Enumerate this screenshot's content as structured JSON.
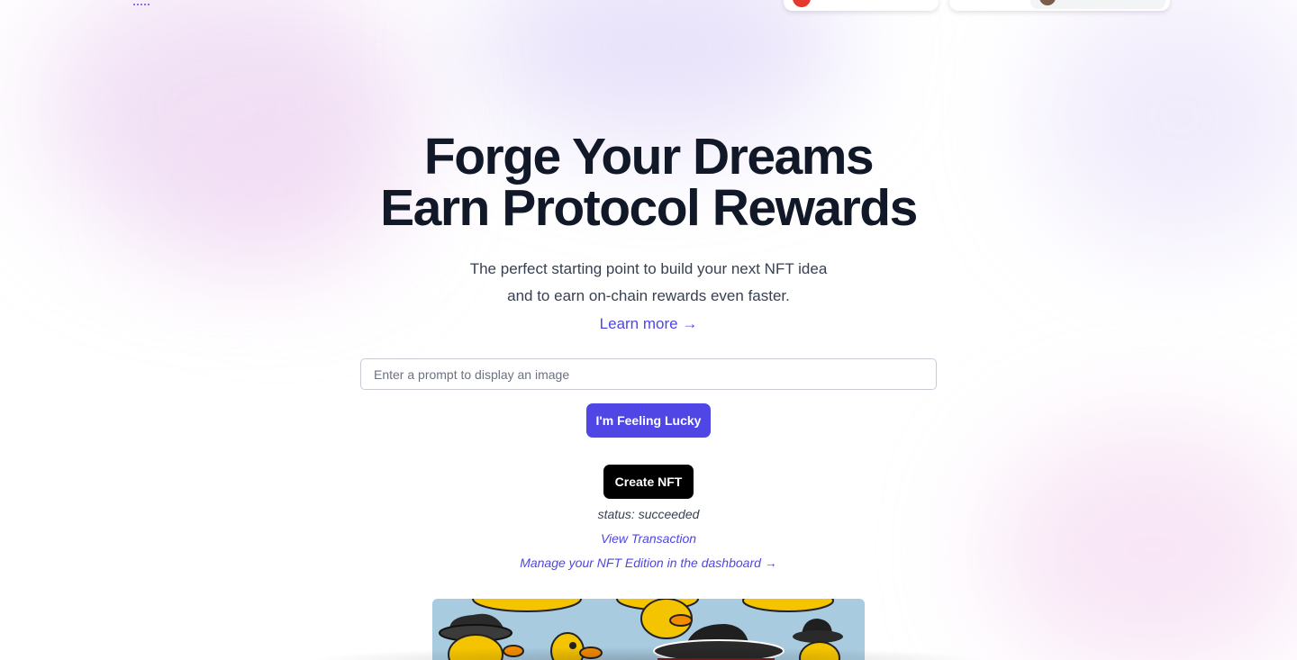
{
  "header": {
    "logo_icon": "dots-logo-icon",
    "chain_badge_icon": "red-chain-icon",
    "account_avatar_icon": "avatar-icon"
  },
  "hero": {
    "title_line1": "Forge Your Dreams",
    "title_line2": "Earn Protocol Rewards",
    "subtitle_line1": "The perfect starting point to build your next NFT idea",
    "subtitle_line2": "and to earn on-chain rewards even faster.",
    "learn_more": "Learn more →"
  },
  "prompt": {
    "value": "",
    "placeholder": "Enter a prompt to display an image"
  },
  "buttons": {
    "lucky": "I'm Feeling Lucky",
    "create": "Create NFT"
  },
  "result": {
    "status": "status: succeeded",
    "view_transaction": "View Transaction",
    "manage_link": "Manage your NFT Edition in the dashboard →"
  },
  "image": {
    "subject": "cowboy rubber ducks"
  },
  "colors": {
    "accent": "#4f46e5",
    "title": "#111827",
    "create_button": "#000000"
  }
}
